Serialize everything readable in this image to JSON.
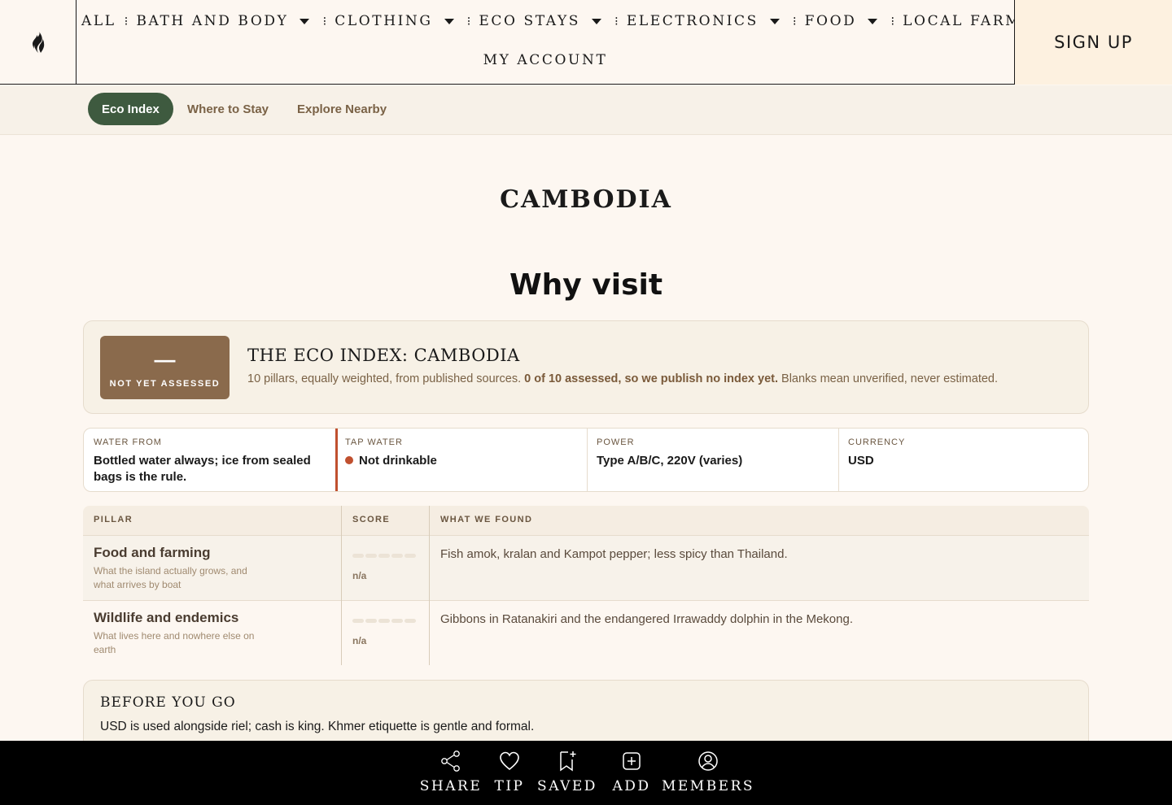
{
  "header": {
    "logo_icon": "flame-icon",
    "nav": [
      {
        "label": "ALL",
        "dropdown": false
      },
      {
        "label": "BATH AND BODY",
        "dropdown": true
      },
      {
        "label": "CLOTHING",
        "dropdown": true
      },
      {
        "label": "ECO STAYS",
        "dropdown": true
      },
      {
        "label": "ELECTRONICS",
        "dropdown": true
      },
      {
        "label": "FOOD",
        "dropdown": true
      },
      {
        "label": "LOCAL FARMS",
        "dropdown": true
      }
    ],
    "my_account": "MY ACCOUNT",
    "sign_up": "SIGN UP"
  },
  "subnav": {
    "tabs": [
      {
        "label": "Eco Index",
        "active": true
      },
      {
        "label": "Where to Stay",
        "active": false
      },
      {
        "label": "Explore Nearby",
        "active": false
      }
    ]
  },
  "page": {
    "country": "CAMBODIA",
    "section_title": "Why visit"
  },
  "eco_index": {
    "badge_value": "—",
    "badge_label": "NOT YET ASSESSED",
    "title": "THE ECO INDEX: CAMBODIA",
    "desc_lead": "10 pillars, equally weighted, from published sources.",
    "desc_bold": "0 of 10 assessed, so we publish no index yet.",
    "desc_tail": "Blanks mean unverified, never estimated."
  },
  "facts": [
    {
      "label": "WATER FROM",
      "value": "Bottled water always; ice from sealed bags is the rule."
    },
    {
      "label": "TAP WATER",
      "value": "Not drinkable"
    },
    {
      "label": "POWER",
      "value": "Type A/B/C, 220V (varies)"
    },
    {
      "label": "CURRENCY",
      "value": "USD"
    }
  ],
  "table": {
    "headers": {
      "pillar": "PILLAR",
      "score": "SCORE",
      "found": "WHAT WE FOUND"
    },
    "rows": [
      {
        "name": "Food and farming",
        "sub": "What the island actually grows, and what arrives by boat",
        "score": "n/a",
        "found": "Fish amok, kralan and Kampot pepper; less spicy than Thailand."
      },
      {
        "name": "Wildlife and endemics",
        "sub": "What lives here and nowhere else on earth",
        "score": "n/a",
        "found": "Gibbons in Ratanakiri and the endangered Irrawaddy dolphin in the Mekong."
      }
    ]
  },
  "before": {
    "title": "BEFORE YOU GO",
    "text": "USD is used alongside riel; cash is king. Khmer etiquette is gentle and formal."
  },
  "bottombar": {
    "items": [
      {
        "label": "SHARE",
        "icon": "share-icon"
      },
      {
        "label": "TIP",
        "icon": "heart-icon"
      },
      {
        "label": "SAVED",
        "icon": "bookmark-plus-icon"
      },
      {
        "label": "ADD",
        "icon": "add-square-icon"
      },
      {
        "label": "MEMBERS",
        "icon": "user-circle-icon"
      }
    ]
  },
  "colors": {
    "accent_green": "#3e5a3f",
    "badge_brown": "#8a6a4c",
    "alert_red": "#c0502f",
    "background": "#fdf7f1"
  }
}
